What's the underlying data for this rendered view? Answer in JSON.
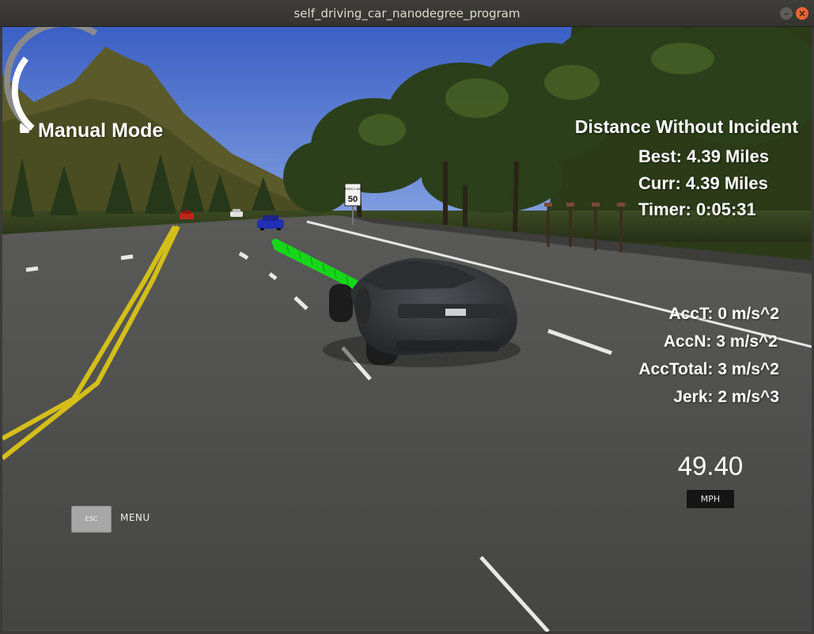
{
  "window": {
    "title": "self_driving_car_nanodegree_program",
    "minimize_glyph": "–",
    "close_glyph": "×"
  },
  "hud": {
    "mode_label": "Manual Mode",
    "distance_title": "Distance Without Incident",
    "best": "Best: 4.39 Miles",
    "curr": "Curr: 4.39 Miles",
    "timer": "Timer: 0:05:31",
    "acc_t": "AccT: 0 m/s^2",
    "acc_n": "AccN: 3 m/s^2",
    "acc_total": "AccTotal: 3 m/s^2",
    "jerk": "Jerk: 2 m/s^3"
  },
  "speedometer": {
    "value": "49.40",
    "unit": "MPH"
  },
  "controls": {
    "esc_label": "ESC",
    "menu_label": "MENU"
  },
  "speed_sign": {
    "top_text": "SPEED LIMIT",
    "value": "50"
  },
  "colors": {
    "sky": "#4c6fcc",
    "road": "#4a4a4a",
    "lane_yellow": "#d8c21a",
    "path_green": "#22dd22",
    "ego_car": "#3a3d40"
  }
}
